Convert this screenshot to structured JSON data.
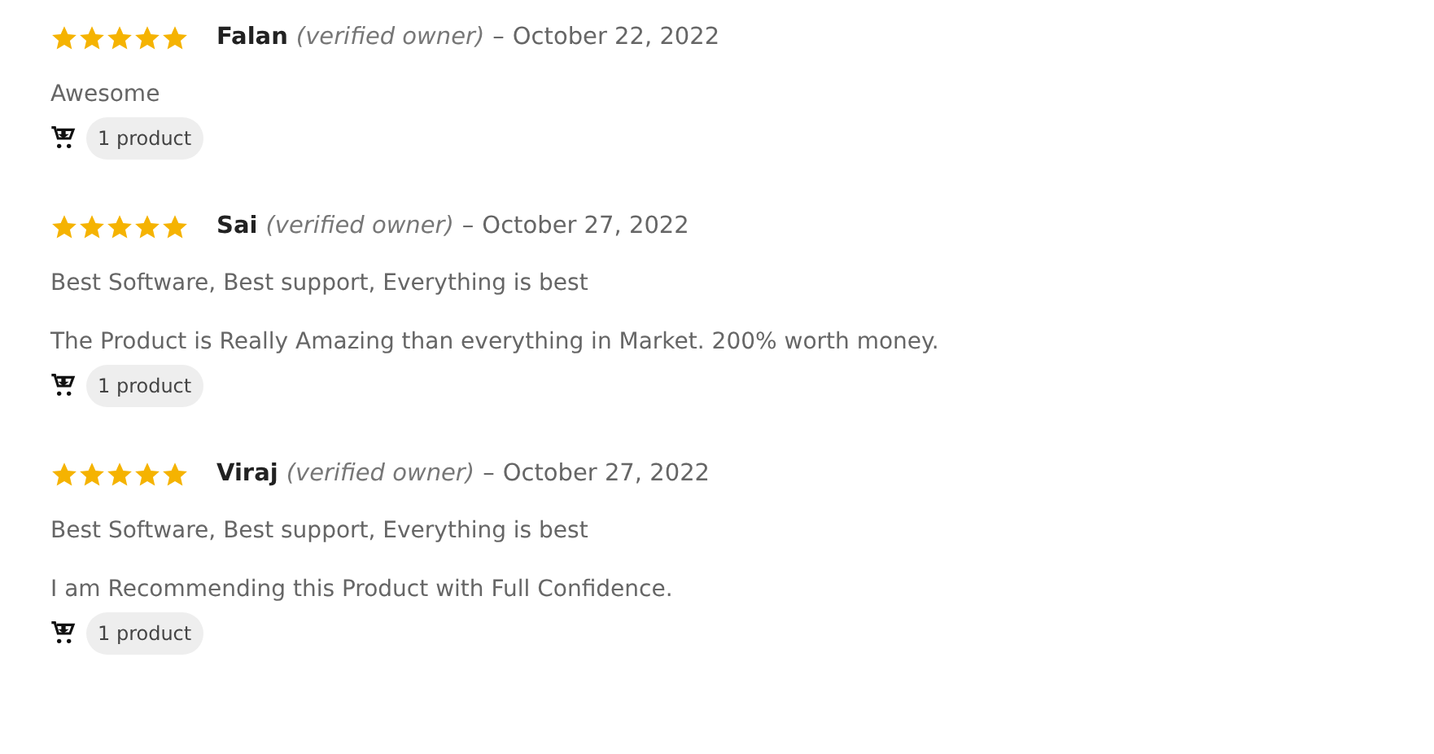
{
  "reviews": [
    {
      "stars": 5,
      "author": "Falan",
      "verified": "(verified owner)",
      "separator": "–",
      "date": "October 22, 2022",
      "paragraphs": [
        "Awesome"
      ],
      "product_badge": "1 product"
    },
    {
      "stars": 5,
      "author": "Sai",
      "verified": "(verified owner)",
      "separator": "–",
      "date": "October 27, 2022",
      "paragraphs": [
        "Best Software, Best support, Everything is best",
        "The Product is Really Amazing than everything in Market. 200% worth money."
      ],
      "product_badge": "1 product"
    },
    {
      "stars": 5,
      "author": "Viraj",
      "verified": "(verified owner)",
      "separator": "–",
      "date": "October 27, 2022",
      "paragraphs": [
        "Best Software, Best support, Everything is best",
        "I am Recommending this Product with Full Confidence."
      ],
      "product_badge": "1 product"
    }
  ]
}
